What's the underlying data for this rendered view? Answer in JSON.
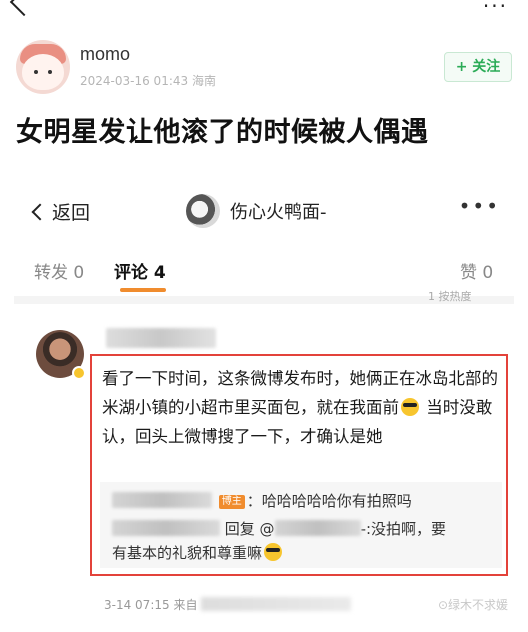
{
  "poster": {
    "name": "momo",
    "meta": "2024-03-16 01:43 海南",
    "follow_label": "+ 关注"
  },
  "post": {
    "title": "女明星发让他滚了的时候被人偶遇"
  },
  "embed": {
    "back_label": "返回",
    "user_name": "伤心火鸭面-",
    "more": "•••",
    "tabs": [
      {
        "label": "转发 0"
      },
      {
        "label": "评论 4"
      },
      {
        "label": "赞 0"
      }
    ],
    "cut_text": "1 按热度",
    "comment": {
      "text_parts": [
        "看了一下时间，这条微博发布时，她俩正在冰岛北部的米湖小镇的小超市里买面包，就在我面前",
        " 当时没敢认，回头上微博搜了一下，才确认是她"
      ],
      "replies": [
        {
          "badge": "博主",
          "text": "：哈哈哈哈哈你有拍照吗"
        },
        {
          "prefix": "回复 @",
          "suffix": "-:没拍啊，要",
          "line2": "有基本的礼貌和尊重嘛"
        }
      ],
      "timestamp": "3-14 07:15 来自"
    },
    "watermark": "⊙绿木不求媛"
  }
}
